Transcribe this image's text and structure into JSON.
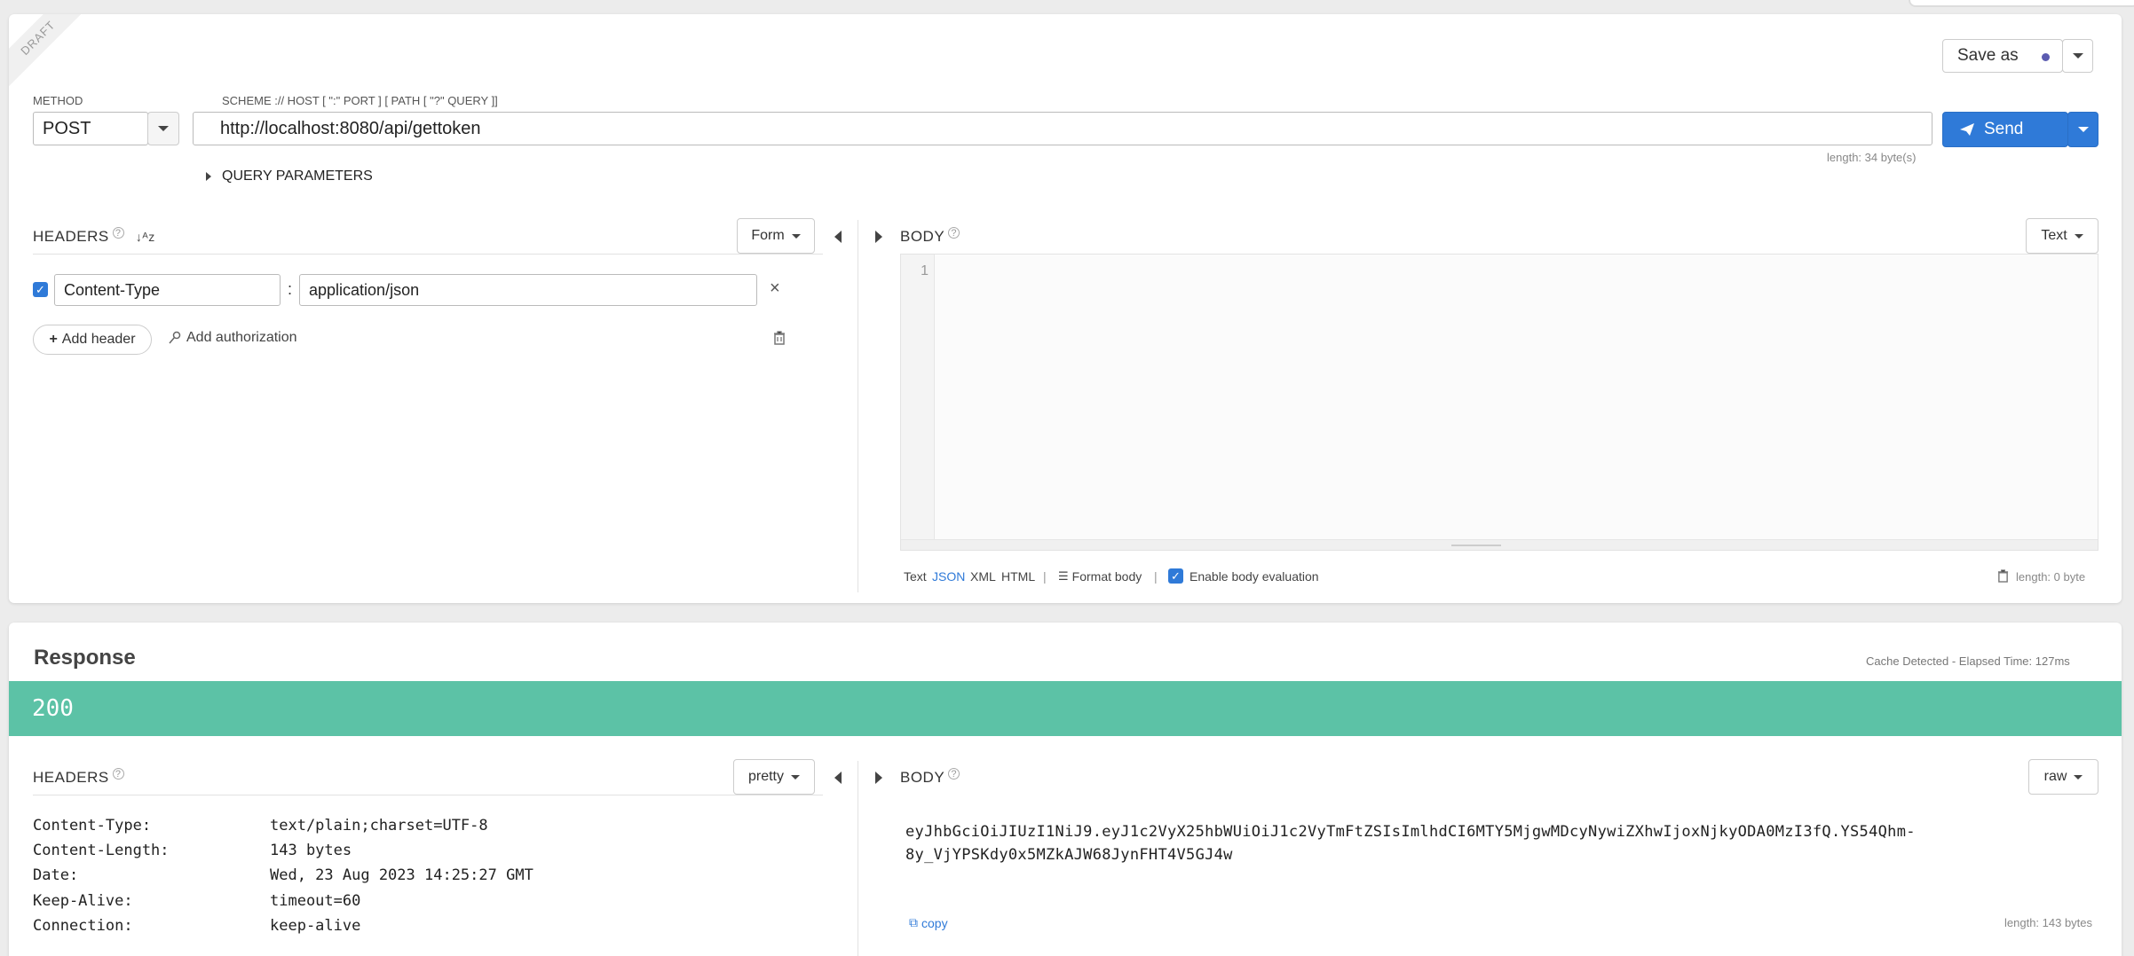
{
  "request": {
    "draft_label": "DRAFT",
    "save_as_label": "Save as",
    "method_label": "METHOD",
    "method_value": "POST",
    "url_label": "SCHEME :// HOST [ \":\" PORT ] [ PATH [ \"?\" QUERY ]]",
    "url_value": "http://localhost:8080/api/gettoken",
    "url_length": "length: 34 byte(s)",
    "send_label": "Send",
    "query_params_label": "QUERY PARAMETERS",
    "headers_title": "HEADERS",
    "headers_mode": "Form",
    "header_row": {
      "name": "Content-Type",
      "value": "application/json",
      "separator": ":"
    },
    "add_header_label": "Add header",
    "add_auth_label": "Add authorization",
    "body_title": "BODY",
    "body_mode": "Text",
    "line_number": "1",
    "body_formats": [
      "Text",
      "JSON",
      "XML",
      "HTML"
    ],
    "separator": "|",
    "format_body_label": "Format body",
    "enable_eval_label": "Enable body evaluation",
    "body_length": "length: 0 byte",
    "accent_color": "#2f7ad8"
  },
  "response": {
    "title": "Response",
    "cache_info": "Cache Detected - Elapsed Time: 127ms",
    "status_code": "200",
    "status_color": "#5cc2a6",
    "headers_title": "HEADERS",
    "headers_mode": "pretty",
    "headers": [
      {
        "name": "Content-Type:",
        "value": "text/plain;charset=UTF-8"
      },
      {
        "name": "Content-Length:",
        "value": "143 bytes"
      },
      {
        "name": "Date:",
        "value": "Wed, 23 Aug 2023 14:25:27 GMT"
      },
      {
        "name": "Keep-Alive:",
        "value": "timeout=60"
      },
      {
        "name": "Connection:",
        "value": "keep-alive"
      }
    ],
    "body_title": "BODY",
    "body_mode": "raw",
    "body_line1": "eyJhbGciOiJIUzI1NiJ9.eyJ1c2VyX25hbWUiOiJ1c2VyTmFtZSIsImlhdCI6MTY5MjgwMDcyNywiZXhwIjoxNjkyODA0MzI3fQ.YS54Qhm-",
    "body_line2": "8y_VjYPSKdy0x5MZkAJW68JynFHT4V5GJ4w",
    "copy_label": "copy",
    "body_length": "length: 143 bytes"
  }
}
